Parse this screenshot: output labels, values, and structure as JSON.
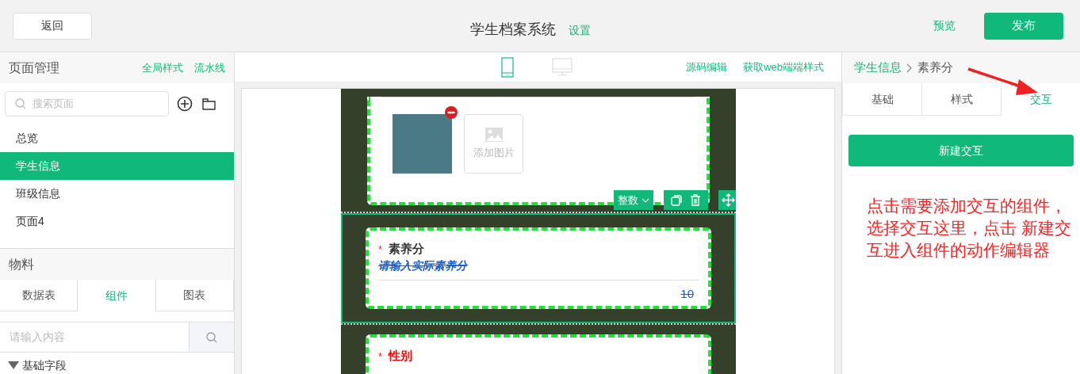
{
  "top_bar": {
    "back_button": "返回",
    "title": "学生档案系统",
    "settings_link": "设置",
    "preview_link": "预览",
    "publish_button": "发布"
  },
  "page_panel": {
    "title": "页面管理",
    "links": [
      "全局样式",
      "流水线"
    ],
    "search": {
      "placeholder": "搜索页面"
    },
    "pages": [
      {
        "label": "总览",
        "selected": false
      },
      {
        "label": "学生信息",
        "selected": true
      },
      {
        "label": "班级信息",
        "selected": false
      },
      {
        "label": "页面4",
        "selected": false
      }
    ]
  },
  "materials_panel": {
    "title": "物料",
    "tabs": [
      {
        "label": "数据表",
        "selected": false
      },
      {
        "label": "组件",
        "selected": true
      },
      {
        "label": "图表",
        "selected": false
      }
    ],
    "search": {
      "placeholder": "请输入内容"
    },
    "group": {
      "label": "基础字段",
      "expanded": true
    }
  },
  "canvas": {
    "devices": [
      {
        "kind": "mobile",
        "selected": true
      },
      {
        "kind": "desktop",
        "selected": false
      }
    ],
    "links": [
      "源码编辑",
      "获取web端端样式"
    ],
    "image_field": {
      "add_label": "添加图片"
    },
    "component_toolbar": {
      "type_dropdown": "整数"
    },
    "fields": [
      {
        "required_mark": "*",
        "label": "素养分",
        "color": "#333333",
        "placeholder": "请输入实际素养分",
        "value": "10",
        "selected": true
      },
      {
        "required_mark": "*",
        "label": "性别",
        "color": "#ff0000",
        "selected": false
      }
    ]
  },
  "inspector": {
    "breadcrumb": [
      "学生信息",
      "素养分"
    ],
    "tabs": [
      {
        "label": "基础",
        "selected": false
      },
      {
        "label": "样式",
        "selected": false
      },
      {
        "label": "交互",
        "selected": true
      }
    ],
    "new_button": "新建交互",
    "annotation": "点击需要添加交互的组件，选择交互这里，点击 新建交互进入组件的动作编辑器"
  }
}
